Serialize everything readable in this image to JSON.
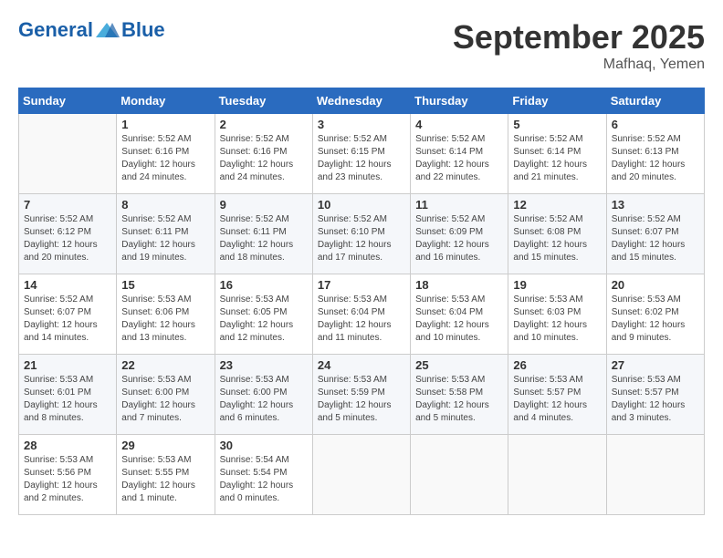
{
  "header": {
    "logo_line1": "General",
    "logo_line2": "Blue",
    "month": "September 2025",
    "location": "Mafhaq, Yemen"
  },
  "days_of_week": [
    "Sunday",
    "Monday",
    "Tuesday",
    "Wednesday",
    "Thursday",
    "Friday",
    "Saturday"
  ],
  "weeks": [
    [
      {
        "num": "",
        "info": ""
      },
      {
        "num": "1",
        "info": "Sunrise: 5:52 AM\nSunset: 6:16 PM\nDaylight: 12 hours\nand 24 minutes."
      },
      {
        "num": "2",
        "info": "Sunrise: 5:52 AM\nSunset: 6:16 PM\nDaylight: 12 hours\nand 24 minutes."
      },
      {
        "num": "3",
        "info": "Sunrise: 5:52 AM\nSunset: 6:15 PM\nDaylight: 12 hours\nand 23 minutes."
      },
      {
        "num": "4",
        "info": "Sunrise: 5:52 AM\nSunset: 6:14 PM\nDaylight: 12 hours\nand 22 minutes."
      },
      {
        "num": "5",
        "info": "Sunrise: 5:52 AM\nSunset: 6:14 PM\nDaylight: 12 hours\nand 21 minutes."
      },
      {
        "num": "6",
        "info": "Sunrise: 5:52 AM\nSunset: 6:13 PM\nDaylight: 12 hours\nand 20 minutes."
      }
    ],
    [
      {
        "num": "7",
        "info": "Sunrise: 5:52 AM\nSunset: 6:12 PM\nDaylight: 12 hours\nand 20 minutes."
      },
      {
        "num": "8",
        "info": "Sunrise: 5:52 AM\nSunset: 6:11 PM\nDaylight: 12 hours\nand 19 minutes."
      },
      {
        "num": "9",
        "info": "Sunrise: 5:52 AM\nSunset: 6:11 PM\nDaylight: 12 hours\nand 18 minutes."
      },
      {
        "num": "10",
        "info": "Sunrise: 5:52 AM\nSunset: 6:10 PM\nDaylight: 12 hours\nand 17 minutes."
      },
      {
        "num": "11",
        "info": "Sunrise: 5:52 AM\nSunset: 6:09 PM\nDaylight: 12 hours\nand 16 minutes."
      },
      {
        "num": "12",
        "info": "Sunrise: 5:52 AM\nSunset: 6:08 PM\nDaylight: 12 hours\nand 15 minutes."
      },
      {
        "num": "13",
        "info": "Sunrise: 5:52 AM\nSunset: 6:07 PM\nDaylight: 12 hours\nand 15 minutes."
      }
    ],
    [
      {
        "num": "14",
        "info": "Sunrise: 5:52 AM\nSunset: 6:07 PM\nDaylight: 12 hours\nand 14 minutes."
      },
      {
        "num": "15",
        "info": "Sunrise: 5:53 AM\nSunset: 6:06 PM\nDaylight: 12 hours\nand 13 minutes."
      },
      {
        "num": "16",
        "info": "Sunrise: 5:53 AM\nSunset: 6:05 PM\nDaylight: 12 hours\nand 12 minutes."
      },
      {
        "num": "17",
        "info": "Sunrise: 5:53 AM\nSunset: 6:04 PM\nDaylight: 12 hours\nand 11 minutes."
      },
      {
        "num": "18",
        "info": "Sunrise: 5:53 AM\nSunset: 6:04 PM\nDaylight: 12 hours\nand 10 minutes."
      },
      {
        "num": "19",
        "info": "Sunrise: 5:53 AM\nSunset: 6:03 PM\nDaylight: 12 hours\nand 10 minutes."
      },
      {
        "num": "20",
        "info": "Sunrise: 5:53 AM\nSunset: 6:02 PM\nDaylight: 12 hours\nand 9 minutes."
      }
    ],
    [
      {
        "num": "21",
        "info": "Sunrise: 5:53 AM\nSunset: 6:01 PM\nDaylight: 12 hours\nand 8 minutes."
      },
      {
        "num": "22",
        "info": "Sunrise: 5:53 AM\nSunset: 6:00 PM\nDaylight: 12 hours\nand 7 minutes."
      },
      {
        "num": "23",
        "info": "Sunrise: 5:53 AM\nSunset: 6:00 PM\nDaylight: 12 hours\nand 6 minutes."
      },
      {
        "num": "24",
        "info": "Sunrise: 5:53 AM\nSunset: 5:59 PM\nDaylight: 12 hours\nand 5 minutes."
      },
      {
        "num": "25",
        "info": "Sunrise: 5:53 AM\nSunset: 5:58 PM\nDaylight: 12 hours\nand 5 minutes."
      },
      {
        "num": "26",
        "info": "Sunrise: 5:53 AM\nSunset: 5:57 PM\nDaylight: 12 hours\nand 4 minutes."
      },
      {
        "num": "27",
        "info": "Sunrise: 5:53 AM\nSunset: 5:57 PM\nDaylight: 12 hours\nand 3 minutes."
      }
    ],
    [
      {
        "num": "28",
        "info": "Sunrise: 5:53 AM\nSunset: 5:56 PM\nDaylight: 12 hours\nand 2 minutes."
      },
      {
        "num": "29",
        "info": "Sunrise: 5:53 AM\nSunset: 5:55 PM\nDaylight: 12 hours\nand 1 minute."
      },
      {
        "num": "30",
        "info": "Sunrise: 5:54 AM\nSunset: 5:54 PM\nDaylight: 12 hours\nand 0 minutes."
      },
      {
        "num": "",
        "info": ""
      },
      {
        "num": "",
        "info": ""
      },
      {
        "num": "",
        "info": ""
      },
      {
        "num": "",
        "info": ""
      }
    ]
  ]
}
